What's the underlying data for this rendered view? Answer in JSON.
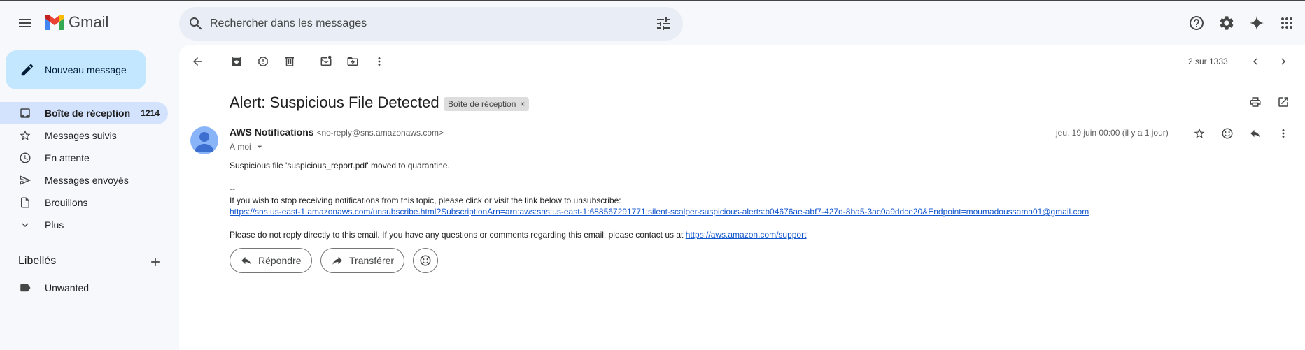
{
  "app": {
    "name": "Gmail"
  },
  "search": {
    "placeholder": "Rechercher dans les messages"
  },
  "compose": {
    "label": "Nouveau message"
  },
  "sidebar": {
    "items": [
      {
        "label": "Boîte de réception",
        "count": "1214"
      },
      {
        "label": "Messages suivis"
      },
      {
        "label": "En attente"
      },
      {
        "label": "Messages envoyés"
      },
      {
        "label": "Brouillons"
      },
      {
        "label": "Plus"
      }
    ],
    "labels_title": "Libellés",
    "labels": [
      {
        "label": "Unwanted"
      }
    ]
  },
  "toolbar": {
    "page_count": "2 sur 1333"
  },
  "email": {
    "subject": "Alert: Suspicious File Detected",
    "badge": "Boîte de réception",
    "badge_close": "×",
    "sender_name": "AWS Notifications",
    "sender_email": "<no-reply@sns.amazonaws.com>",
    "to": "À moi",
    "date": "jeu. 19 juin 00:00 (il y a 1 jour)",
    "body_line1": "Suspicious file 'suspicious_report.pdf' moved to quarantine.",
    "separator": "--",
    "unsubscribe_text": "If you wish to stop receiving notifications from this topic, please click or visit the link below to unsubscribe:",
    "unsubscribe_link": "https://sns.us-east-1.amazonaws.com/unsubscribe.html?SubscriptionArn=arn:aws:sns:us-east-1:688567291771:silent-scalper-suspicious-alerts:b04676ae-abf7-427d-8ba5-3ac0a9ddce20&Endpoint=moumadoussama01@gmail.com",
    "footer_text": "Please do not reply directly to this email. If you have any questions or comments regarding this email, please contact us at",
    "support_link": "https://aws.amazon.com/support"
  },
  "actions": {
    "reply": "Répondre",
    "forward": "Transférer"
  },
  "colors": {
    "accent": "#c2e7ff",
    "active_nav": "#d3e3fd",
    "link": "#1155cc",
    "background": "#f6f8fc"
  }
}
